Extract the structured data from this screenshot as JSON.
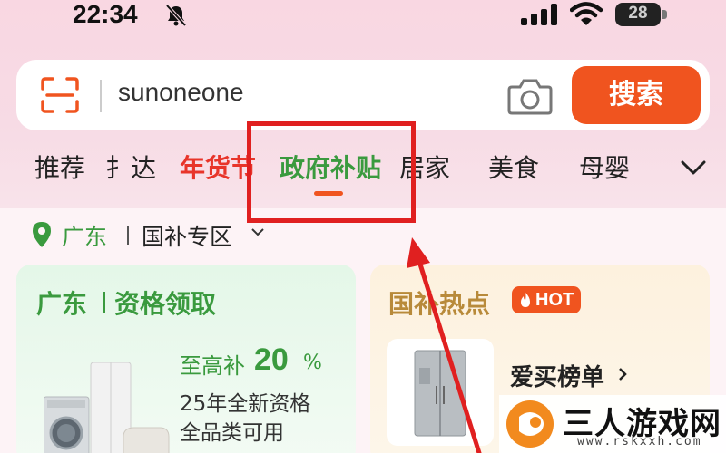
{
  "status_bar": {
    "time": "22:34",
    "battery": "28",
    "icons": [
      "bell-muted-icon",
      "signal-icon",
      "wifi-icon",
      "battery-icon"
    ]
  },
  "search": {
    "query": "sunoneone",
    "button_label": "搜索",
    "icons": [
      "scan-icon",
      "camera-icon"
    ],
    "accent_color": "#f0541f"
  },
  "tabs": [
    {
      "label": "推荐"
    },
    {
      "label": "扌达"
    },
    {
      "label": "年货节"
    },
    {
      "label": "政府补贴"
    },
    {
      "label": "居家"
    },
    {
      "label": "美食"
    },
    {
      "label": "母婴"
    }
  ],
  "active_tab": "政府补贴",
  "location": {
    "city": "广东",
    "zone": "国补专区"
  },
  "card_left": {
    "title_city": "广东",
    "title_action": "资格领取",
    "subsidy_prefix": "至高补",
    "subsidy_value": "20",
    "subsidy_unit": "%",
    "line2": "25年全新资格",
    "line3": "全品类可用",
    "color": "#3a9a3e"
  },
  "card_right": {
    "title": "国补热点",
    "badge": "HOT",
    "rank_label": "爱买榜单"
  },
  "watermark": {
    "name": "三人游戏网",
    "url": "www.rskxxh.com"
  }
}
